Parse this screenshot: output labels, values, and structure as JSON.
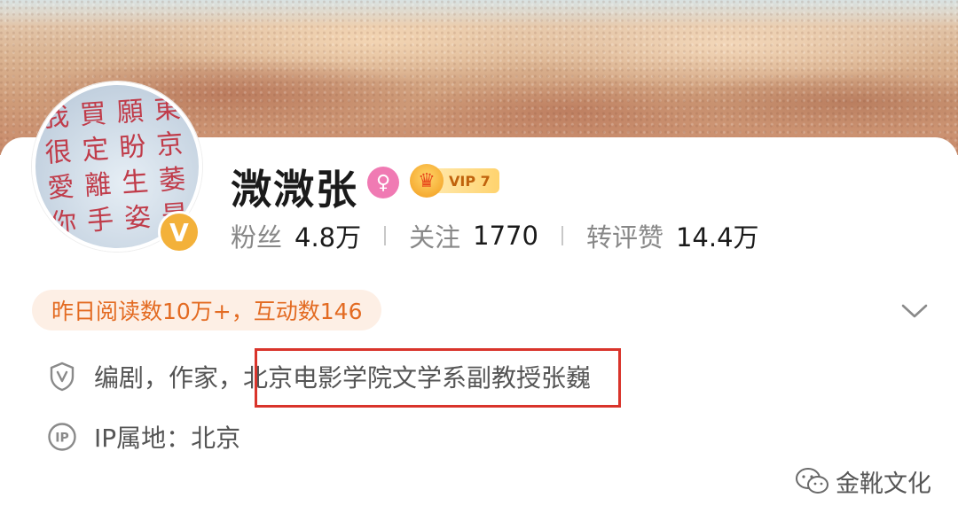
{
  "profile": {
    "name": "溦溦张",
    "avatar_text": [
      "我",
      "買",
      "願",
      "東",
      "很",
      "定",
      "盼",
      "京",
      "愛",
      "離",
      "生",
      "萎",
      "你",
      "手",
      "姿",
      "是"
    ],
    "gender_icon": "female-icon",
    "vip_level": "VIP 7"
  },
  "stats": [
    {
      "label": "粉丝",
      "value": "4.8万"
    },
    {
      "label": "关注",
      "value": "1770"
    },
    {
      "label": "转评赞",
      "value": "14.4万"
    }
  ],
  "activity": {
    "text": "昨日阅读数10万+，互动数146"
  },
  "info": {
    "bio": "编剧，作家，北京电影学院文学系副教授张巍",
    "ip_location": "IP属地：北京"
  },
  "watermark": {
    "text": "金靴文化"
  },
  "colors": {
    "accent_orange": "#e36b22",
    "verified_gold": "#f3b13a",
    "highlight_red": "#d9342b",
    "gender_pink": "#f07ab3"
  }
}
